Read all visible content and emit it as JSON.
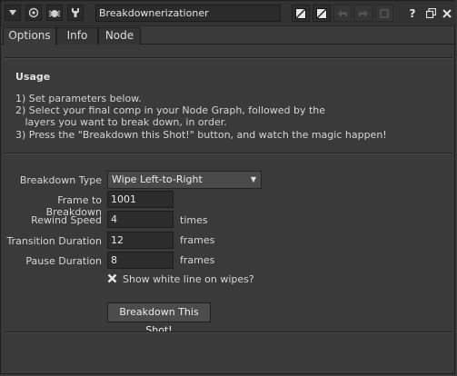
{
  "window": {
    "title": "Breakdownerizationer",
    "icons": {
      "collapse": "triangle-down-icon",
      "node": "circle-dot-icon",
      "bug": "bug-icon",
      "wrench": "wrench-icon",
      "slash1": "color-swatch-icon",
      "slash2": "color-swatch-icon",
      "undo": "undo-icon",
      "redo": "redo-icon",
      "reset": "reset-icon",
      "help": "help-icon",
      "float": "float-window-icon",
      "close": "close-icon"
    },
    "help_label": "?"
  },
  "tabs": [
    {
      "label": "Options",
      "active": true
    },
    {
      "label": "Info",
      "active": false
    },
    {
      "label": "Node",
      "active": false
    }
  ],
  "usage": {
    "title": "Usage",
    "lines": [
      "1) Set parameters below.",
      "2) Select your final comp in your Node Graph, followed by the",
      "   layers you want to break down, in order.",
      "3) Press the \"Breakdown this Shot!\" button, and watch the magic happen!"
    ]
  },
  "params": {
    "breakdown_type": {
      "label": "Breakdown Type",
      "value": "Wipe Left-to-Right"
    },
    "frame_to_breakdown": {
      "label": "Frame to Breakdown",
      "value": "1001"
    },
    "rewind_speed": {
      "label": "Rewind Speed",
      "value": "4",
      "unit": "times"
    },
    "transition_duration": {
      "label": "Transition Duration",
      "value": "12",
      "unit": "frames"
    },
    "pause_duration": {
      "label": "Pause Duration",
      "value": "8",
      "unit": "frames"
    },
    "show_white_line": {
      "label": "Show white line on wipes?",
      "checked": true
    }
  },
  "action_button": {
    "label": "Breakdown This Shot!"
  }
}
